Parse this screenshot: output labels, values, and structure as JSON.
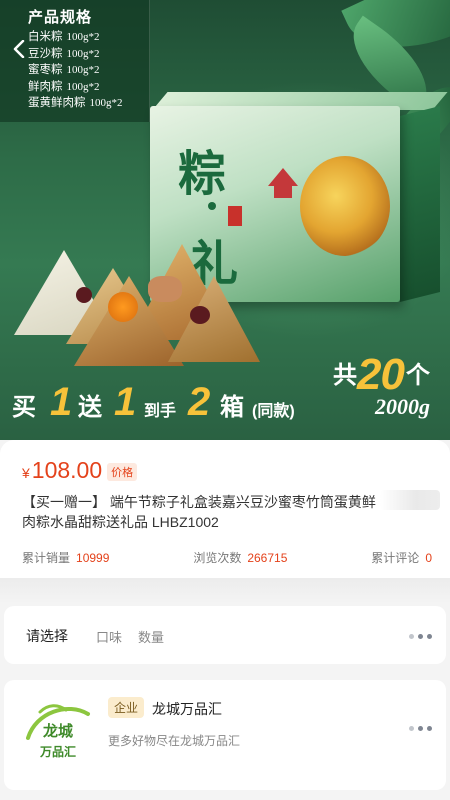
{
  "hero": {
    "spec_title": "产品规格",
    "spec_items": [
      {
        "name": "白米粽",
        "weight": "100g*2"
      },
      {
        "name": "豆沙粽",
        "weight": "100g*2"
      },
      {
        "name": "蜜枣粽",
        "weight": "100g*2"
      },
      {
        "name": "鲜肉粽",
        "weight": "100g*2"
      },
      {
        "name": "蛋黄鲜肉粽",
        "weight": "100g*2"
      }
    ],
    "box_char_1": "粽",
    "box_char_2": "礼",
    "promo": {
      "buy": "买",
      "buy_num": "1",
      "give": "送",
      "give_num": "1",
      "arrive": "到手",
      "arrive_num": "2",
      "box": "箱",
      "same": "(同款)"
    },
    "total": {
      "prefix": "共",
      "count": "20",
      "unit": "个"
    },
    "weight": "2000g",
    "colors": {
      "accent_gold": "#f7c23a",
      "green_dark": "#1f4d34"
    }
  },
  "product": {
    "currency": "¥",
    "price": "108.00",
    "price_tag": "价格",
    "title": "【买一赠一】 端午节粽子礼盒装嘉兴豆沙蜜枣竹筒蛋黄鲜肉粽水晶甜粽送礼品 LHBZ1002",
    "stats": [
      {
        "label": "累计销量",
        "value": "10999"
      },
      {
        "label": "浏览次数",
        "value": "266715"
      },
      {
        "label": "累计评论",
        "value": "0"
      }
    ],
    "accent_color": "#e4421b"
  },
  "select": {
    "label": "请选择",
    "options": [
      "口味",
      "数量"
    ],
    "more_icon": "more-dots-icon"
  },
  "shop": {
    "badge": "企业",
    "name": "龙城万品汇",
    "desc": "更多好物尽在龙城万品汇",
    "logo_line1": "龙城",
    "logo_line2": "万品汇",
    "more_icon": "more-dots-icon"
  }
}
